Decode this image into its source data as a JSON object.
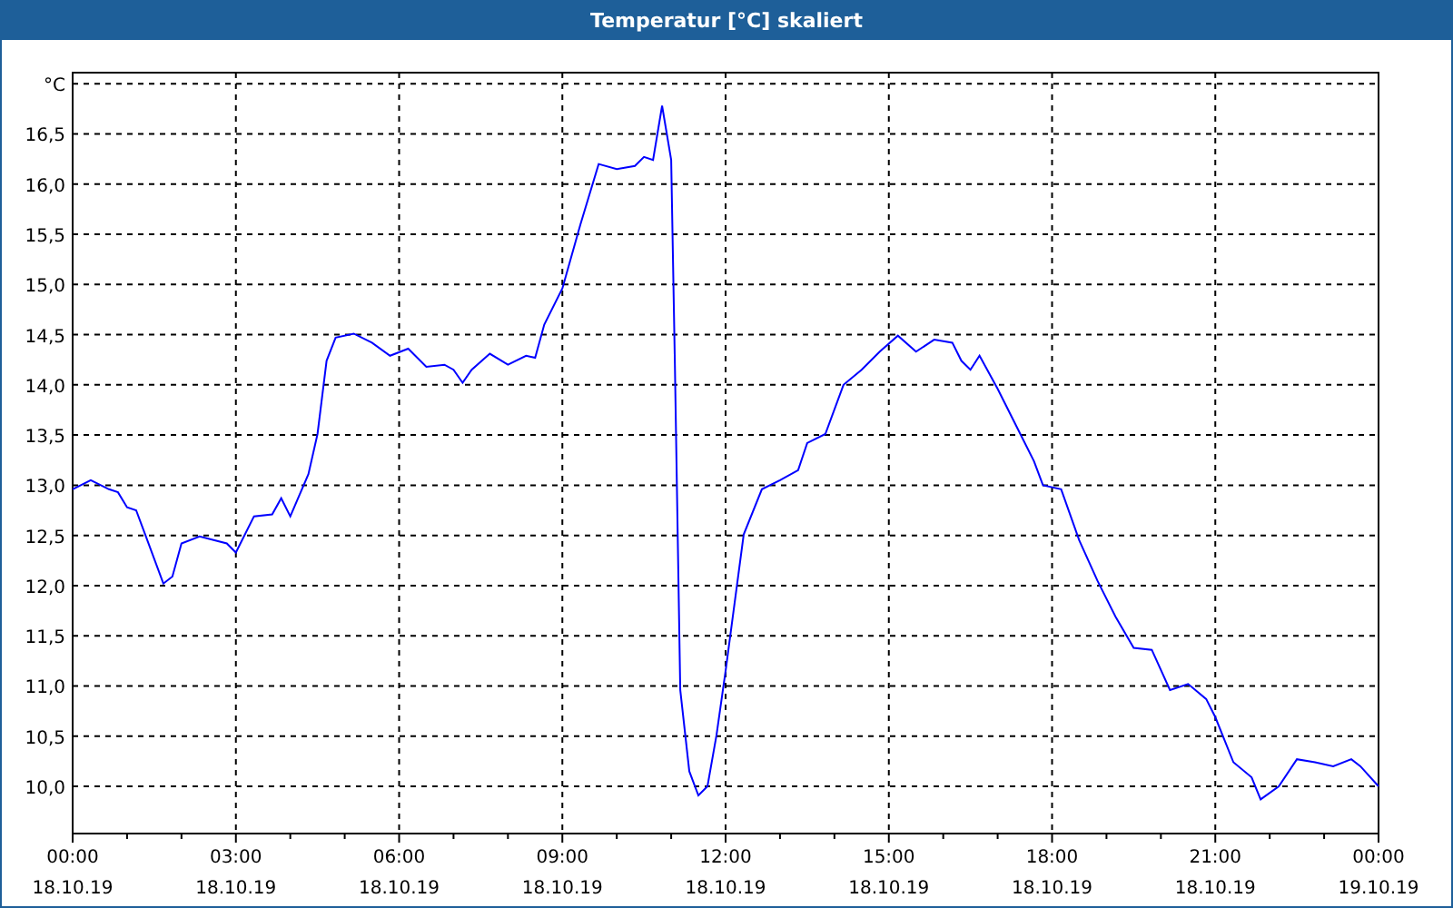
{
  "window": {
    "title": "Temperatur [°C] skaliert"
  },
  "chart": {
    "chart_data": {
      "type": "line",
      "grid": true,
      "xlim": [
        0,
        24
      ],
      "ylim": [
        9.53,
        17.11
      ],
      "x": [
        0,
        0.333,
        0.667,
        0.833,
        1.0,
        1.167,
        1.333,
        1.667,
        1.833,
        2.0,
        2.333,
        2.833,
        3.0,
        3.333,
        3.667,
        3.833,
        4.0,
        4.333,
        4.5,
        4.667,
        4.833,
        5.167,
        5.5,
        5.833,
        6.167,
        6.5,
        6.833,
        7.0,
        7.167,
        7.333,
        7.667,
        8.0,
        8.333,
        8.5,
        8.667,
        9.0,
        9.333,
        9.667,
        10.0,
        10.333,
        10.5,
        10.667,
        10.833,
        11.0,
        11.067,
        11.167,
        11.333,
        11.5,
        11.667,
        11.833,
        12.0,
        12.333,
        12.667,
        13.0,
        13.333,
        13.5,
        13.833,
        14.167,
        14.5,
        14.833,
        15.167,
        15.5,
        15.833,
        16.167,
        16.333,
        16.5,
        16.667,
        17.0,
        17.333,
        17.667,
        17.833,
        18.167,
        18.5,
        18.833,
        19.167,
        19.5,
        19.833,
        20.167,
        20.5,
        20.833,
        21.0,
        21.333,
        21.667,
        21.833,
        22.167,
        22.5,
        22.833,
        23.167,
        23.5,
        23.667,
        24.0
      ],
      "series": [
        {
          "color": "#0000ff",
          "values": [
            12.96,
            13.05,
            12.96,
            12.93,
            12.78,
            12.75,
            12.51,
            12.02,
            12.09,
            12.42,
            12.49,
            12.42,
            12.33,
            12.69,
            12.71,
            12.87,
            12.69,
            13.11,
            13.51,
            14.24,
            14.47,
            14.51,
            14.42,
            14.29,
            14.36,
            14.18,
            14.2,
            14.15,
            14.02,
            14.15,
            14.31,
            14.2,
            14.29,
            14.27,
            14.6,
            14.96,
            15.6,
            16.2,
            16.15,
            16.18,
            16.27,
            16.24,
            16.78,
            16.24,
            14.24,
            10.96,
            10.15,
            9.91,
            10.0,
            10.51,
            11.15,
            12.51,
            12.96,
            13.05,
            13.15,
            13.42,
            13.51,
            14.0,
            14.15,
            14.33,
            14.49,
            14.33,
            14.45,
            14.42,
            14.24,
            14.15,
            14.29,
            13.96,
            13.6,
            13.24,
            13.0,
            12.96,
            12.45,
            12.05,
            11.69,
            11.38,
            11.36,
            10.96,
            11.02,
            10.87,
            10.69,
            10.24,
            10.09,
            9.87,
            10.0,
            10.27,
            10.24,
            10.2,
            10.27,
            10.2,
            10.0
          ]
        }
      ],
      "xticks": [
        {
          "value": 0,
          "label": "00:00"
        },
        {
          "value": 3,
          "label": "03:00"
        },
        {
          "value": 6,
          "label": "06:00"
        },
        {
          "value": 9,
          "label": "09:00"
        },
        {
          "value": 12,
          "label": "12:00"
        },
        {
          "value": 15,
          "label": "15:00"
        },
        {
          "value": 18,
          "label": "18:00"
        },
        {
          "value": 21,
          "label": "21:00"
        },
        {
          "value": 24,
          "label": "00:00"
        }
      ],
      "yticks": [
        {
          "value": 10,
          "label": "10,0"
        },
        {
          "value": 10.5,
          "label": "10,5"
        },
        {
          "value": 11,
          "label": "11,0"
        },
        {
          "value": 11.5,
          "label": "11,5"
        },
        {
          "value": 12,
          "label": "12,0"
        },
        {
          "value": 12.5,
          "label": "12,5"
        },
        {
          "value": 13,
          "label": "13,0"
        },
        {
          "value": 13.5,
          "label": "13,5"
        },
        {
          "value": 14,
          "label": "14,0"
        },
        {
          "value": 14.5,
          "label": "14,5"
        },
        {
          "value": 15,
          "label": "15,0"
        },
        {
          "value": 15.5,
          "label": "15,5"
        },
        {
          "value": 16,
          "label": "16,0"
        },
        {
          "value": 16.5,
          "label": "16,5"
        },
        {
          "value": 17,
          "label": "°C"
        }
      ]
    },
    "xtick_dates": [
      "18.10.19",
      "18.10.19",
      "18.10.19",
      "18.10.19",
      "18.10.19",
      "18.10.19",
      "18.10.19",
      "18.10.19",
      "19.10.19"
    ]
  }
}
